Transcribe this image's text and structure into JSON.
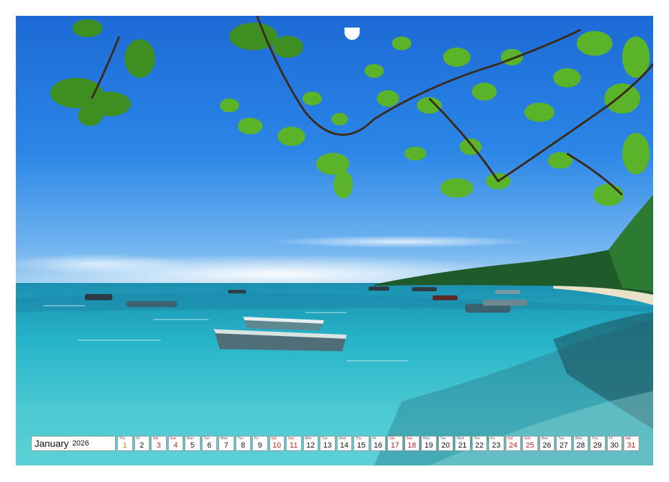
{
  "calendar": {
    "month": "January",
    "year": "2026",
    "days": [
      {
        "dow": "Thu",
        "num": "1",
        "type": "hol"
      },
      {
        "dow": "Fri",
        "num": "2",
        "type": ""
      },
      {
        "dow": "Sat",
        "num": "3",
        "type": "sat"
      },
      {
        "dow": "Sun",
        "num": "4",
        "type": "sun"
      },
      {
        "dow": "Mon",
        "num": "5",
        "type": ""
      },
      {
        "dow": "Tue",
        "num": "6",
        "type": ""
      },
      {
        "dow": "Wed",
        "num": "7",
        "type": ""
      },
      {
        "dow": "Thu",
        "num": "8",
        "type": ""
      },
      {
        "dow": "Fri",
        "num": "9",
        "type": ""
      },
      {
        "dow": "Sat",
        "num": "10",
        "type": "sat"
      },
      {
        "dow": "Sun",
        "num": "11",
        "type": "sun"
      },
      {
        "dow": "Mon",
        "num": "12",
        "type": ""
      },
      {
        "dow": "Tue",
        "num": "13",
        "type": ""
      },
      {
        "dow": "Wed",
        "num": "14",
        "type": ""
      },
      {
        "dow": "Thu",
        "num": "15",
        "type": ""
      },
      {
        "dow": "Fri",
        "num": "16",
        "type": ""
      },
      {
        "dow": "Sat",
        "num": "17",
        "type": "sat"
      },
      {
        "dow": "Sun",
        "num": "18",
        "type": "sun"
      },
      {
        "dow": "Mon",
        "num": "19",
        "type": ""
      },
      {
        "dow": "Tue",
        "num": "20",
        "type": ""
      },
      {
        "dow": "Wed",
        "num": "21",
        "type": ""
      },
      {
        "dow": "Thu",
        "num": "22",
        "type": ""
      },
      {
        "dow": "Fri",
        "num": "23",
        "type": ""
      },
      {
        "dow": "Sat",
        "num": "24",
        "type": "sat"
      },
      {
        "dow": "Sun",
        "num": "25",
        "type": "sun"
      },
      {
        "dow": "Mon",
        "num": "26",
        "type": ""
      },
      {
        "dow": "Tue",
        "num": "27",
        "type": ""
      },
      {
        "dow": "Wed",
        "num": "28",
        "type": ""
      },
      {
        "dow": "Thu",
        "num": "29",
        "type": ""
      },
      {
        "dow": "Fri",
        "num": "30",
        "type": ""
      },
      {
        "dow": "Sat",
        "num": "31",
        "type": "sat"
      }
    ]
  }
}
